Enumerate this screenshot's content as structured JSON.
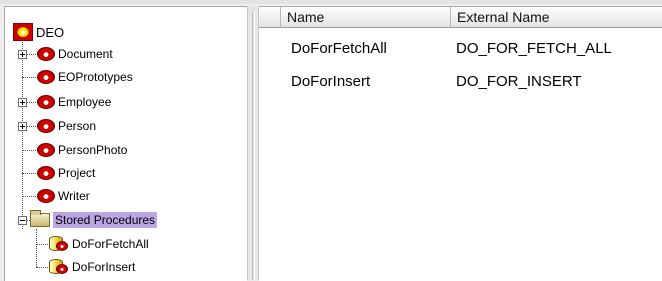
{
  "tree": {
    "root": "DEO",
    "items": [
      {
        "label": "Document",
        "expandable": true
      },
      {
        "label": "EOPrototypes",
        "expandable": false
      },
      {
        "label": "Employee",
        "expandable": true
      },
      {
        "label": "Person",
        "expandable": true
      },
      {
        "label": "PersonPhoto",
        "expandable": false
      },
      {
        "label": "Project",
        "expandable": false
      },
      {
        "label": "Writer",
        "expandable": false
      }
    ],
    "stored_procedures": {
      "label": "Stored Procedures",
      "children": [
        "DoForFetchAll",
        "DoForInsert"
      ]
    }
  },
  "table": {
    "columns": [
      "Name",
      "External Name"
    ],
    "rows": [
      {
        "name": "DoForFetchAll",
        "external_name": "DO_FOR_FETCH_ALL"
      },
      {
        "name": "DoForInsert",
        "external_name": "DO_FOR_INSERT"
      }
    ]
  },
  "icons": {
    "root": "eomodel-icon",
    "entity": "entity-icon",
    "folder": "folder-icon",
    "procedure": "stored-procedure-icon"
  },
  "colors": {
    "selection": "#bba6e6",
    "entity_red": "#d40000"
  }
}
